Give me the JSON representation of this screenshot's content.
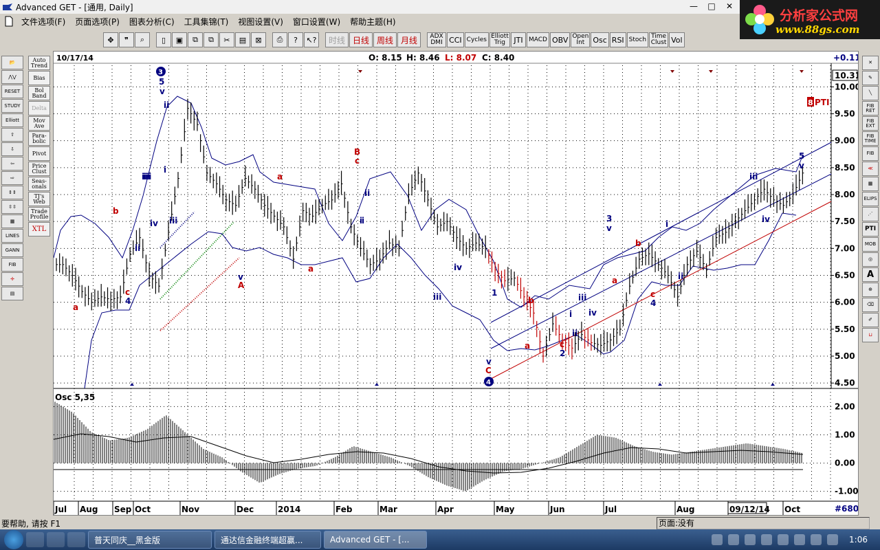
{
  "window": {
    "title": "Advanced GET - [通用, Daily]",
    "minimize": "—",
    "maximize": "□",
    "close": "✕"
  },
  "logo": {
    "line1": "分析家公式网",
    "line2": "www.88gs.com"
  },
  "menu": [
    "文件选项(F)",
    "页面选项(P)",
    "图表分析(C)",
    "工具集锦(T)",
    "视图设置(V)",
    "窗口设置(W)",
    "帮助主题(H)"
  ],
  "toolbar": {
    "periods": [
      "时线",
      "日线",
      "周线",
      "月线"
    ],
    "studies": [
      "ADX DMI",
      "CCI",
      "Cycles",
      "Elliott Trig",
      "JTI",
      "MACD",
      "OBV",
      "Open Int",
      "Osc",
      "RSI",
      "Stoch",
      "Time Clust",
      "Vol"
    ]
  },
  "left_tools": [
    "Elliott",
    "RESET",
    "STUDY",
    "LINES",
    "GANN",
    "FIB"
  ],
  "study_buttons": [
    "Auto Trend",
    "Bias",
    "Bol Band",
    "Delta",
    "Mov Ave",
    "Para-bolic",
    "Pivot",
    "Price Clust",
    "Seas-onals",
    "TJ's Web",
    "Trade Profile",
    "XTL"
  ],
  "right_tools": [
    "FIB RET",
    "FIB EXT",
    "FIB TIME",
    "FIB",
    "ELIPS",
    "PTI",
    "MOB",
    "A"
  ],
  "header": {
    "date": "10/17/14",
    "open": "O: 8.15",
    "high": "H: 8.46",
    "low": "L: 8.07",
    "close": "C: 8.40",
    "change": "+0.11"
  },
  "price_axis": {
    "current": "10.31",
    "ticks": [
      "10.00",
      "9.50",
      "9.00",
      "8.50",
      "8.00",
      "7.50",
      "7.00",
      "6.50",
      "6.00",
      "5.50",
      "5.00",
      "4.50"
    ]
  },
  "pti": {
    "value": "8",
    "label": "PTI"
  },
  "osc": {
    "label": "Osc 5,35",
    "ticks": [
      "2.00",
      "1.00",
      "0.00",
      "-1.00"
    ]
  },
  "months": [
    "Jul",
    "Aug",
    "Sep",
    "Oct",
    "Nov",
    "Dec",
    "2014",
    "Feb",
    "Mar",
    "Apr",
    "May",
    "Jun",
    "Jul",
    "Aug",
    "09/12/14",
    "Oct"
  ],
  "bars_count": "#680",
  "wave_labels": {
    "blue": [
      "5",
      "v",
      "iii",
      "ii",
      "i",
      "iv",
      "iii",
      "4",
      "v",
      "ii",
      "i",
      "iii",
      "iv",
      "1",
      "v",
      "2",
      "iii",
      "iv",
      "i",
      "ii",
      "3",
      "v",
      "i",
      "4",
      "ii",
      "iii",
      "iv",
      "5",
      "v",
      "iv",
      "iii",
      "ii",
      "i"
    ],
    "red": [
      "b",
      "a",
      "c",
      "a",
      "A",
      "B",
      "c",
      "a",
      "C",
      "b",
      "a",
      "c",
      "b",
      "a",
      "c"
    ],
    "circled": [
      "3",
      "4"
    ]
  },
  "status": {
    "help": "要帮助, 请按 F1",
    "page": "页面:没有"
  },
  "taskbar": {
    "tasks": [
      "普天同庆__黑金版",
      "通达信金融终端超赢...",
      "Advanced GET - [..."
    ],
    "clock": "1:06"
  },
  "chart_data": {
    "type": "line",
    "title": "",
    "ylim": [
      4.4,
      10.4
    ],
    "series": [
      {
        "values": [
          6.7,
          6.5,
          6.2,
          6.0,
          6.1,
          6.05,
          6.1,
          6.9,
          7.2,
          6.5,
          6.3,
          7.3,
          8.3,
          9.6,
          9.3,
          8.4,
          8.2,
          7.9,
          7.8,
          8.3,
          8.1,
          7.8,
          7.6,
          7.4,
          6.8,
          7.7,
          7.6,
          7.8,
          7.9,
          8.2,
          7.4,
          7.0,
          6.7,
          6.8,
          7.1,
          7.0,
          8.0,
          8.4,
          7.9,
          7.4,
          7.5,
          7.2,
          7.0,
          7.1,
          7.0,
          6.6,
          6.4,
          6.45,
          6.1,
          5.8,
          5.0,
          5.6,
          5.3,
          5.15,
          5.4,
          5.25,
          5.2,
          5.3,
          5.5,
          6.3,
          6.8,
          6.9,
          6.7,
          6.5,
          6.1,
          6.7,
          6.95,
          6.6,
          7.2,
          7.3,
          7.5,
          7.7,
          7.9,
          8.1,
          7.9,
          7.8,
          8.0,
          8.4
        ]
      }
    ],
    "osc_values": [
      2.2,
      1.8,
      1.1,
      0.8,
      0.9,
      1.2,
      1.7,
      1.1,
      0.5,
      0.2,
      -0.3,
      -0.7,
      -0.4,
      -0.2,
      -0.1,
      0.2,
      0.6,
      0.4,
      0.2,
      -0.1,
      -0.5,
      -0.8,
      -1.0,
      -0.6,
      -0.3,
      -0.2,
      0.0,
      0.2,
      0.6,
      1.0,
      0.9,
      0.6,
      0.4,
      0.3,
      0.4,
      0.5,
      0.6,
      0.7,
      0.6,
      0.5,
      0.35
    ]
  }
}
